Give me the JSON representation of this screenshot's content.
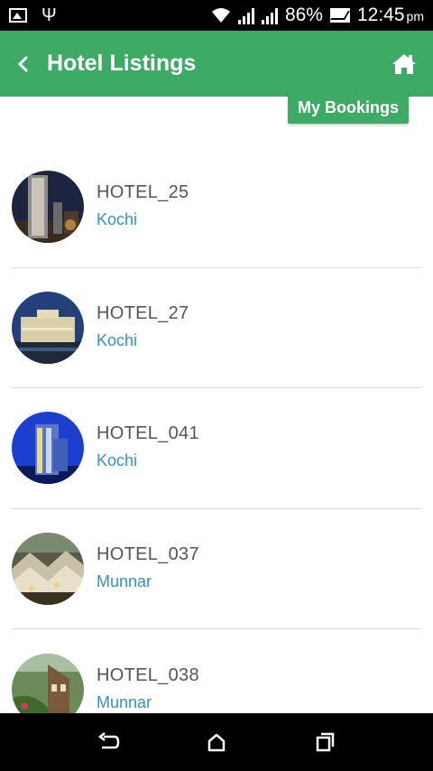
{
  "status_bar": {
    "battery": "86%",
    "time": "12:45",
    "ampm": "pm",
    "icons": [
      "image-icon",
      "usb-icon",
      "wifi-icon",
      "signal-icon",
      "signal-icon",
      "message-icon"
    ]
  },
  "app_bar": {
    "back_icon": "chevron-left-icon",
    "title": "Hotel Listings",
    "home_icon": "home-icon"
  },
  "my_bookings_label": "My Bookings",
  "colors": {
    "primary": "#3dab65",
    "city": "#2f93c9",
    "name": "#555555"
  },
  "hotels": [
    {
      "name": "HOTEL_25",
      "city": "Kochi"
    },
    {
      "name": "HOTEL_27",
      "city": "Kochi"
    },
    {
      "name": "HOTEL_041",
      "city": "Kochi"
    },
    {
      "name": "HOTEL_037",
      "city": "Munnar"
    },
    {
      "name": "HOTEL_038",
      "city": "Munnar"
    }
  ],
  "nav_bar": {
    "icons": [
      "back-icon",
      "home-icon",
      "recents-icon"
    ]
  }
}
